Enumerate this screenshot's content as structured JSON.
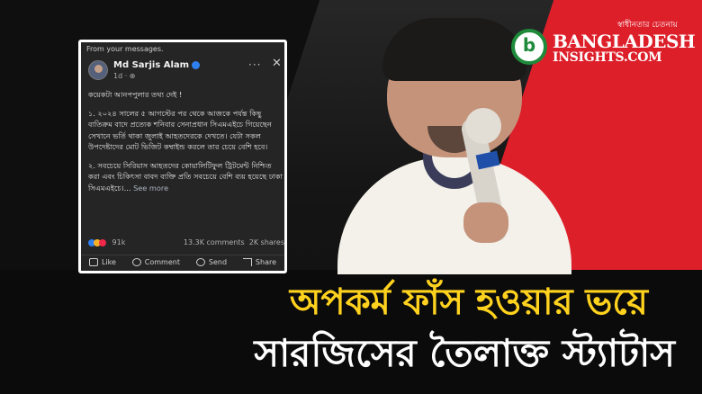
{
  "post": {
    "from_label": "From your messages.",
    "author": "Md Sarjis Alam",
    "meta": "1d · ",
    "paragraphs": [
      "কয়েকটা আনপপুলার তথ্য দেই !",
      "১. ২০২৪ সালের ৫ আগস্টের পর থেকে আজকে পর্যন্ত কিছু ব্যতিক্রম বাদে প্রত্যেক শনিবার সেনাপ্রধান সিএমএইচে গিয়েছেন সেখানে ভর্তি থাকা জুলাই আহতদেরকে দেখতে। যেটা সকল উপদেষ্টাদের মোট ভিজিট কম্বাইন্ড করলে তার চেয়ে বেশি হবে।",
      "২. সবচেয়ে সিরিয়াস আহতদের কোয়ালিটিফুল ট্রিটমেন্ট নিশ্চিত করা এবং চিকিৎসা বাবদ ব্যক্তি প্রতি সবচেয়ে বেশি ব্যয় হয়েছে ঢাকা সিএমএইচে।... "
    ],
    "see_more": "See more",
    "reactions_count": "91k",
    "comments": "13.3K comments",
    "shares": "2K shares",
    "actions": [
      "Like",
      "Comment",
      "Send",
      "Share"
    ]
  },
  "logo": {
    "tagline": "স্বাধীনতার চেতনায়",
    "letter": "b",
    "line1": "BANGLADESH",
    "line2": "INSIGHTS.COM"
  },
  "headline": {
    "line1": "অপকর্ম ফাঁস হওয়ার ভয়ে",
    "line2": "সারজিসের তৈলাক্ত স্ট্যাটাস"
  },
  "colors": {
    "brand_red": "#dd1f2a",
    "headline_yellow": "#ffd21e",
    "logo_green": "#1f8a3a",
    "fb_blue": "#2e7ff0"
  }
}
